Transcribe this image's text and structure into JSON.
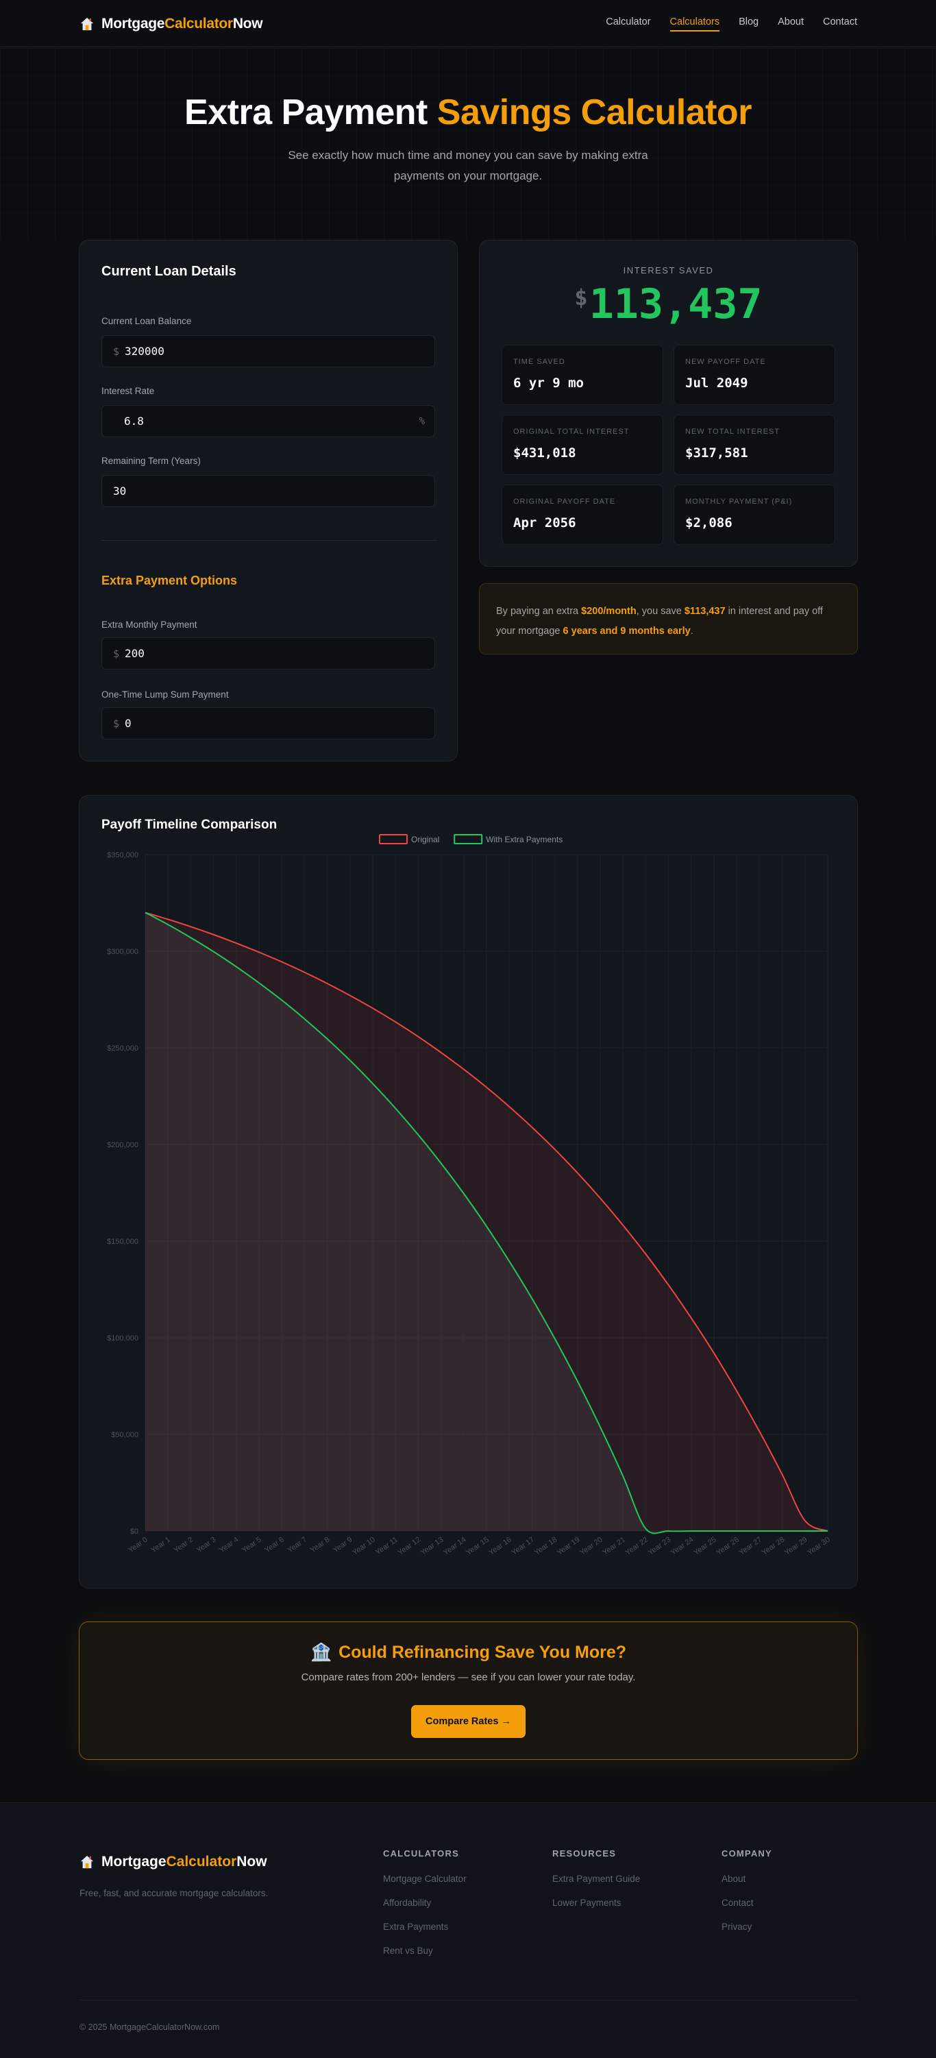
{
  "nav": {
    "logo_part1": "Mortgage",
    "logo_part2": "Calculator",
    "logo_part3": "Now",
    "links": [
      "Calculator",
      "Calculators",
      "Blog",
      "About",
      "Contact"
    ],
    "active": "Calculators"
  },
  "hero": {
    "title_main": "Extra Payment ",
    "title_accent": "Savings Calculator",
    "subtitle": "See exactly how much time and money you can save by making extra payments on your mortgage."
  },
  "loan": {
    "heading": "Current Loan Details",
    "balance_label": "Current Loan Balance",
    "balance_prefix": "$",
    "balance_value": "320000",
    "rate_label": "Interest Rate",
    "rate_value": "6.8",
    "rate_suffix": "%",
    "term_label": "Remaining Term (Years)",
    "term_value": "30",
    "extra_heading": "Extra Payment Options",
    "monthly_label": "Extra Monthly Payment",
    "monthly_prefix": "$",
    "monthly_value": "200",
    "lump_label": "One-Time Lump Sum Payment",
    "lump_prefix": "$",
    "lump_value": "0"
  },
  "results": {
    "interest_label": "INTEREST SAVED",
    "interest_dollar": "$",
    "interest_value": "113,437",
    "stats": [
      {
        "label": "TIME SAVED",
        "value": "6 yr 9 mo"
      },
      {
        "label": "NEW PAYOFF DATE",
        "value": "Jul 2049"
      },
      {
        "label": "ORIGINAL TOTAL INTEREST",
        "value": "$431,018"
      },
      {
        "label": "NEW TOTAL INTEREST",
        "value": "$317,581"
      },
      {
        "label": "ORIGINAL PAYOFF DATE",
        "value": "Apr 2056"
      },
      {
        "label": "MONTHLY PAYMENT (P&I)",
        "value": "$2,086"
      }
    ]
  },
  "summary": {
    "t1": "By paying an extra ",
    "b1": "$200/month",
    "t2": ", you save ",
    "b2": "$113,437",
    "t3": " in interest and pay off your mortgage ",
    "b3": "6 years and 9 months early",
    "t4": "."
  },
  "chart_data": {
    "type": "area",
    "title": "Payoff Timeline Comparison",
    "categories": [
      "Year 0",
      "Year 1",
      "Year 2",
      "Year 3",
      "Year 4",
      "Year 5",
      "Year 6",
      "Year 7",
      "Year 8",
      "Year 9",
      "Year 10",
      "Year 11",
      "Year 12",
      "Year 13",
      "Year 14",
      "Year 15",
      "Year 16",
      "Year 17",
      "Year 18",
      "Year 19",
      "Year 20",
      "Year 21",
      "Year 22",
      "Year 23",
      "Year 24",
      "Year 25",
      "Year 26",
      "Year 27",
      "Year 28",
      "Year 29",
      "Year 30"
    ],
    "y_ticks": [
      "$0",
      "$50,000",
      "$100,000",
      "$150,000",
      "$200,000",
      "$250,000",
      "$300,000",
      "$350,000"
    ],
    "ylim": [
      0,
      350000
    ],
    "series": [
      {
        "name": "Original",
        "color": "#ef4444",
        "values": [
          320000,
          316500,
          312700,
          308600,
          304200,
          299500,
          294500,
          289100,
          283300,
          277100,
          270500,
          263400,
          255800,
          247600,
          238900,
          229600,
          219600,
          208900,
          197500,
          185300,
          172200,
          158200,
          143300,
          127300,
          110200,
          92000,
          72400,
          51500,
          29200,
          5300,
          0
        ]
      },
      {
        "name": "With Extra Payments",
        "color": "#22c55e",
        "values": [
          320000,
          313800,
          307000,
          299800,
          292000,
          283600,
          274700,
          265000,
          254600,
          243500,
          231500,
          218700,
          205000,
          190300,
          174600,
          157700,
          139600,
          120300,
          99600,
          77500,
          53800,
          28400,
          1200,
          0,
          0,
          0,
          0,
          0,
          0,
          0,
          0
        ]
      }
    ],
    "grid": true,
    "legend": "top-center"
  },
  "refi": {
    "emoji": "🏦",
    "heading": "Could Refinancing Save You More?",
    "sub": "Compare rates from 200+ lenders — see if you can lower your rate today.",
    "button": "Compare Rates →"
  },
  "footer": {
    "tagline": "Free, fast, and accurate mortgage calculators.",
    "cols": [
      {
        "heading": "CALCULATORS",
        "items": [
          "Mortgage Calculator",
          "Affordability",
          "Extra Payments",
          "Rent vs Buy"
        ]
      },
      {
        "heading": "RESOURCES",
        "items": [
          "Extra Payment Guide",
          "Lower Payments"
        ]
      },
      {
        "heading": "COMPANY",
        "items": [
          "About",
          "Contact",
          "Privacy"
        ]
      }
    ],
    "copyright": "© 2025 MortgageCalculatorNow.com"
  }
}
